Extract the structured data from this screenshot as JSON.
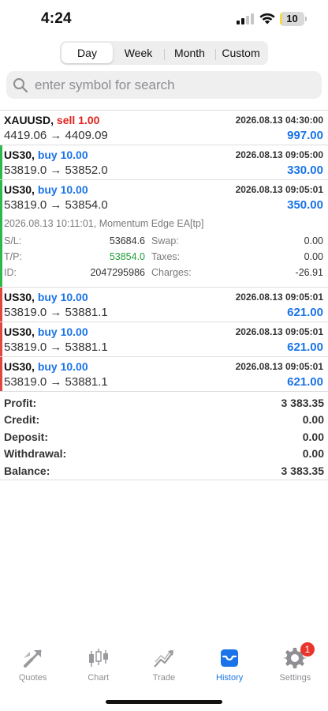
{
  "status_bar": {
    "time": "4:24",
    "battery": "10",
    "battery_level": 0.1
  },
  "period_tabs": [
    {
      "label": "Day",
      "active": true
    },
    {
      "label": "Week",
      "active": false
    },
    {
      "label": "Month",
      "active": false
    },
    {
      "label": "Custom",
      "active": false
    }
  ],
  "search": {
    "placeholder": "enter symbol for search"
  },
  "deals": [
    {
      "symbol": "XAUUSD,",
      "side": "sell 1.00",
      "side_type": "sell",
      "time": "2026.08.13 04:30:00",
      "prices": "4419.06 → 4409.09",
      "profit": "997.00",
      "accent": ""
    },
    {
      "symbol": "US30,",
      "side": "buy 10.00",
      "side_type": "buy",
      "time": "2026.08.13 09:05:00",
      "prices": "53819.0 → 53852.0",
      "profit": "330.00",
      "accent": "#2db84b"
    },
    {
      "symbol": "US30,",
      "side": "buy 10.00",
      "side_type": "buy",
      "time": "2026.08.13 09:05:01",
      "prices": "53819.0 → 53854.0",
      "profit": "350.00",
      "accent": "#2db84b",
      "details": {
        "header": "2026.08.13 10:11:01, Momentum Edge EA[tp]",
        "sl_label": "S/L:",
        "sl": "53684.6",
        "tp_label": "T/P:",
        "tp": "53854.0",
        "id_label": "ID:",
        "id": "2047295986",
        "swap_label": "Swap:",
        "swap": "0.00",
        "taxes_label": "Taxes:",
        "taxes": "0.00",
        "charges_label": "Charges:",
        "charges": "-26.91"
      }
    },
    {
      "symbol": "US30,",
      "side": "buy 10.00",
      "side_type": "buy",
      "time": "2026.08.13 09:05:01",
      "prices": "53819.0 → 53881.1",
      "profit": "621.00",
      "accent": "#e0473f"
    },
    {
      "symbol": "US30,",
      "side": "buy 10.00",
      "side_type": "buy",
      "time": "2026.08.13 09:05:01",
      "prices": "53819.0 → 53881.1",
      "profit": "621.00",
      "accent": "#e0473f"
    },
    {
      "symbol": "US30,",
      "side": "buy 10.00",
      "side_type": "buy",
      "time": "2026.08.13 09:05:01",
      "prices": "53819.0 → 53881.1",
      "profit": "621.00",
      "accent": "#e0473f"
    }
  ],
  "summary": [
    {
      "label": "Profit:",
      "value": "3 383.35"
    },
    {
      "label": "Credit:",
      "value": "0.00"
    },
    {
      "label": "Deposit:",
      "value": "0.00"
    },
    {
      "label": "Withdrawal:",
      "value": "0.00"
    },
    {
      "label": "Balance:",
      "value": "3 383.35"
    }
  ],
  "tabbar": [
    {
      "label": "Quotes",
      "icon": "quotes-icon",
      "active": false
    },
    {
      "label": "Chart",
      "icon": "candlestick-chart-icon",
      "active": false
    },
    {
      "label": "Trade",
      "icon": "trade-icon",
      "active": false
    },
    {
      "label": "History",
      "icon": "inbox-icon",
      "active": true
    },
    {
      "label": "Settings",
      "icon": "gear-icon",
      "active": false,
      "badge": "1"
    }
  ],
  "colors": {
    "accent_blue": "#1a73e8",
    "sell_red": "#e3221b",
    "tp_green": "#1f9d3a",
    "inactive_gray": "#8e8e93"
  }
}
